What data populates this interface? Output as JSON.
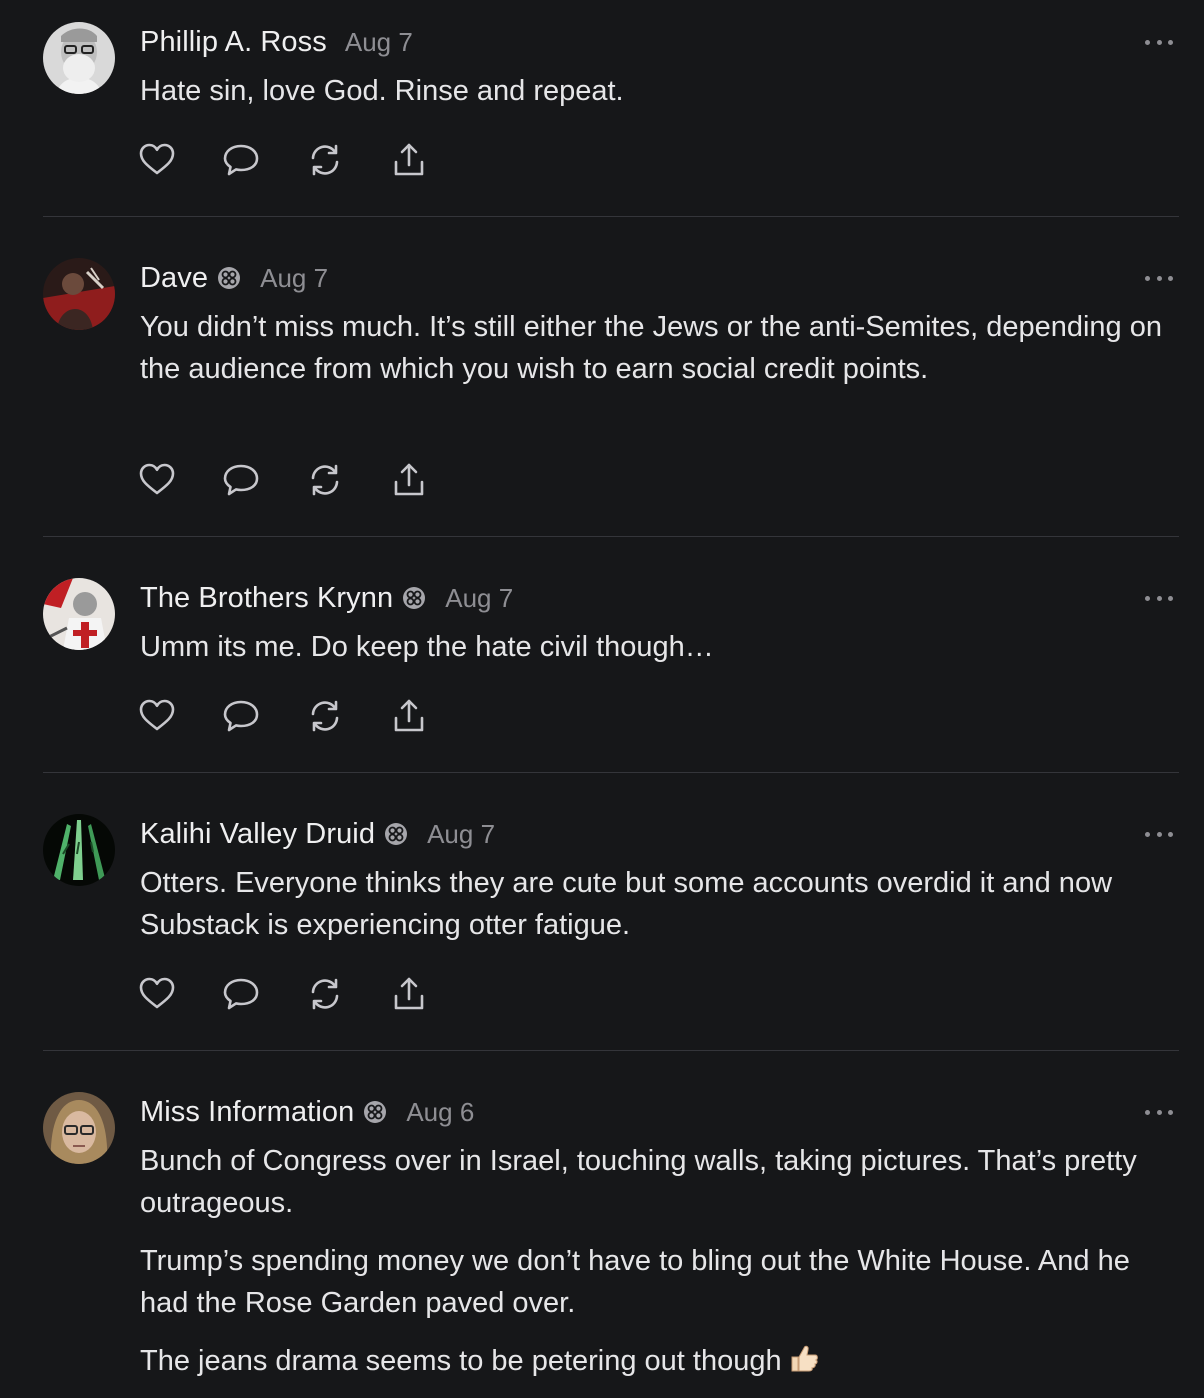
{
  "posts": [
    {
      "author": "Phillip A. Ross",
      "date": "Aug 7",
      "badge": false,
      "paragraphs": [
        "Hate sin, love God. Rinse and repeat."
      ]
    },
    {
      "author": "Dave",
      "date": "Aug 7",
      "badge": true,
      "paragraphs": [
        "You didn’t miss much. It’s still either the Jews or the anti-Semites, depending on the audience from which you wish to earn social credit points."
      ]
    },
    {
      "author": "The Brothers Krynn",
      "date": "Aug 7",
      "badge": true,
      "paragraphs": [
        "Umm its me. Do keep the hate civil though…"
      ]
    },
    {
      "author": "Kalihi Valley Druid",
      "date": "Aug 7",
      "badge": true,
      "paragraphs": [
        "Otters. Everyone thinks they are cute but some accounts overdid it and now Substack is experiencing otter fatigue."
      ]
    },
    {
      "author": "Miss Information",
      "date": "Aug 6",
      "badge": true,
      "paragraphs": [
        "Bunch of Congress over in Israel, touching walls, taking pictures. That’s pretty outrageous.",
        "Trump’s spending money we don’t have to bling out the White House. And he had the Rose Garden paved over.",
        "The jeans drama seems to be petering out though"
      ],
      "trailing_emoji": "thumbs-up-icon"
    }
  ],
  "icons": {
    "like": "heart-icon",
    "comment": "comment-icon",
    "restack": "restack-icon",
    "share": "share-icon",
    "more": "more-icon",
    "badge": "subscriber-badge-icon"
  },
  "colors": {
    "background": "#161719",
    "text": "#e6e6e8",
    "muted": "#8e8e93",
    "divider": "#34353a"
  }
}
